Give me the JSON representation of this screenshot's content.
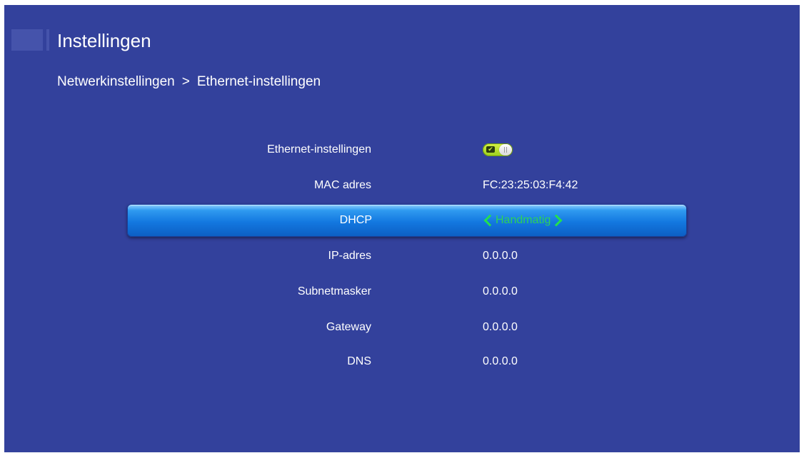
{
  "header": {
    "title": "Instellingen"
  },
  "breadcrumb": {
    "parent": "Netwerkinstellingen",
    "separator": ">",
    "current": "Ethernet-instellingen"
  },
  "settings": {
    "ethernet": {
      "label": "Ethernet-instellingen",
      "toggle_state": "on",
      "toggle_color": "#c4e63a"
    },
    "mac": {
      "label": "MAC adres",
      "value": "FC:23:25:03:F4:42"
    },
    "dhcp": {
      "label": "DHCP",
      "value": "Handmatig",
      "value_color": "#2ed15a"
    },
    "ip": {
      "label": "IP-adres",
      "value": "0.0.0.0"
    },
    "subnet": {
      "label": "Subnetmasker",
      "value": "0.0.0.0"
    },
    "gateway": {
      "label": "Gateway",
      "value": "0.0.0.0"
    },
    "dns": {
      "label": "DNS",
      "value": "0.0.0.0"
    }
  },
  "colors": {
    "background": "#33419c",
    "selected_row": "#1378e0"
  }
}
